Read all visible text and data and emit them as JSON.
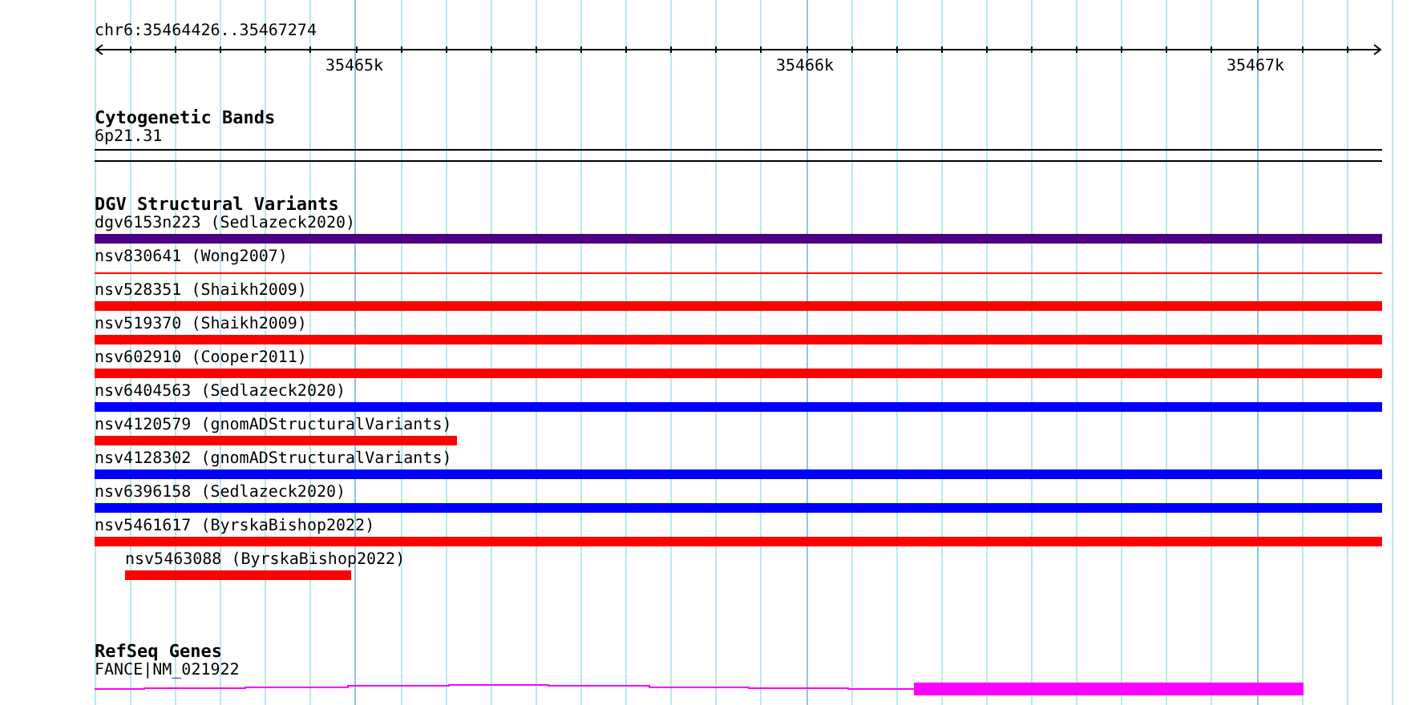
{
  "region": "chr6:35464426..35467274",
  "ruler": {
    "tick_labels": [
      "35465k",
      "35466k",
      "35467k"
    ]
  },
  "tracks": [
    {
      "kind": "cytoband",
      "title": "Cytogenetic Bands",
      "features": [
        {
          "label": "6p21.31"
        }
      ]
    },
    {
      "kind": "variants",
      "title": "DGV Structural Variants",
      "features": [
        {
          "label": "dgv6153n223 (Sedlazeck2020)",
          "kind": "full",
          "color": "#4b0082"
        },
        {
          "label": "nsv830641 (Wong2007)",
          "kind": "thin",
          "color": "#ff0000"
        },
        {
          "label": "nsv528351 (Shaikh2009)",
          "kind": "full",
          "color": "#ff0000"
        },
        {
          "label": "nsv519370 (Shaikh2009)",
          "kind": "full",
          "color": "#ff0000"
        },
        {
          "label": "nsv602910 (Cooper2011)",
          "kind": "full",
          "color": "#ff0000"
        },
        {
          "label": "nsv6404563 (Sedlazeck2020)",
          "kind": "full",
          "color": "#0000ff"
        },
        {
          "label": "nsv4120579 (gnomADStructuralVariants)",
          "kind": "partial",
          "color": "#ff0000"
        },
        {
          "label": "nsv4128302 (gnomADStructuralVariants)",
          "kind": "full",
          "color": "#0000ff"
        },
        {
          "label": "nsv6396158 (Sedlazeck2020)",
          "kind": "full",
          "color": "#0000ff"
        },
        {
          "label": "nsv5461617 (ByrskaBishop2022)",
          "kind": "full",
          "color": "#ff0000"
        },
        {
          "label": "nsv5463088 (ByrskaBishop2022)",
          "kind": "indented",
          "color": "#ff0000"
        }
      ]
    },
    {
      "kind": "genes",
      "title": "RefSeq Genes",
      "features": [
        {
          "label": "FANCE|NM_021922"
        }
      ]
    }
  ]
}
